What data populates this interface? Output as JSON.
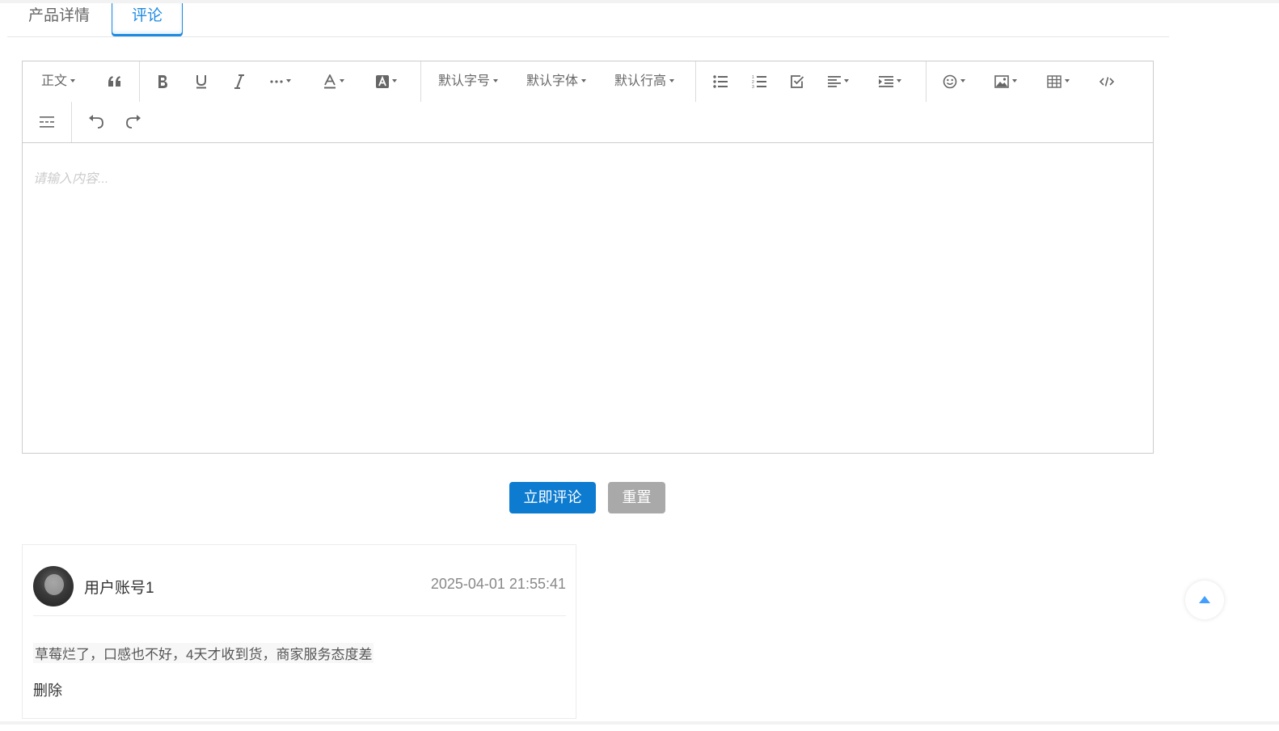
{
  "tabs": [
    {
      "label": "产品详情",
      "active": false
    },
    {
      "label": "评论",
      "active": true
    }
  ],
  "toolbar": {
    "heading": "正文",
    "font_size": "默认字号",
    "font_family": "默认字体",
    "line_height": "默认行高",
    "icons": [
      "quote-icon",
      "bold-icon",
      "underline-icon",
      "italic-icon",
      "more-icon",
      "font-color-icon",
      "background-color-icon",
      "bulleted-list-icon",
      "numbered-list-icon",
      "todo-icon",
      "justify-icon",
      "indent-icon",
      "emotion-icon",
      "image-icon",
      "table-icon",
      "code-icon",
      "divider-icon",
      "undo-icon",
      "redo-icon"
    ]
  },
  "editor": {
    "placeholder": "请输入内容..."
  },
  "actions": {
    "submit_label": "立即评论",
    "reset_label": "重置"
  },
  "comments": [
    {
      "username": "用户账号1",
      "time": "2025-04-01 21:55:41",
      "text": "草莓烂了，口感也不好，4天才收到货，商家服务态度差",
      "delete_label": "删除"
    }
  ],
  "colors": {
    "accent": "#1e8ae0",
    "primary_button": "#0d7bd0",
    "reset_button": "#a9a9a9",
    "backtop_arrow": "#409eff"
  }
}
